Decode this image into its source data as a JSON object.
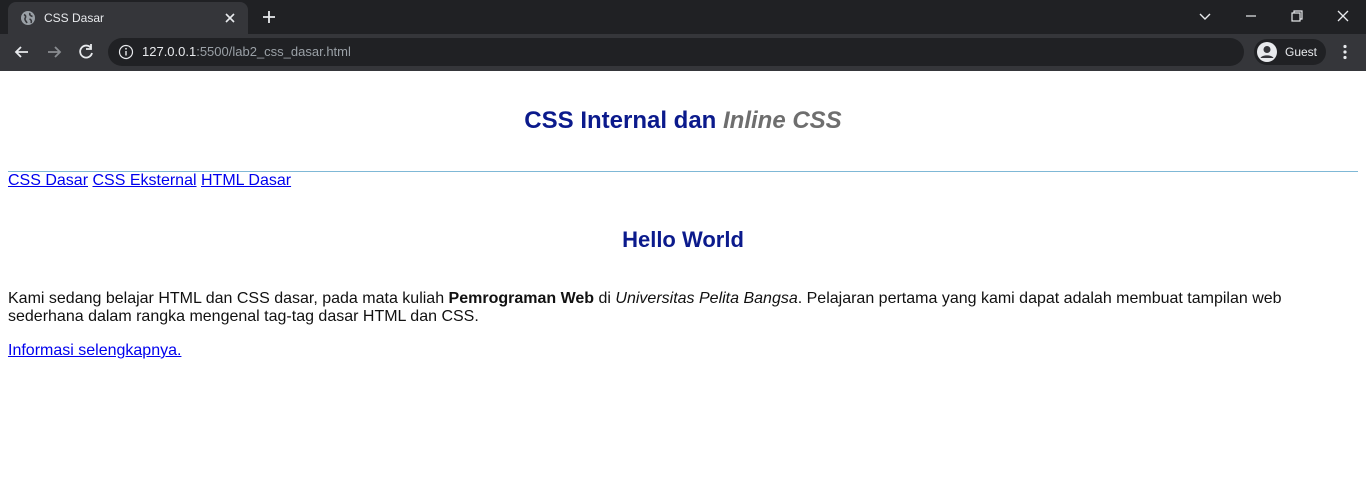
{
  "browser": {
    "tab_title": "CSS Dasar",
    "url_host": "127.0.0.1",
    "url_rest": ":5500/lab2_css_dasar.html",
    "profile_label": "Guest",
    "icons": [
      "globe-icon",
      "close-icon",
      "plus-icon",
      "chevron-down-icon",
      "minimize-icon",
      "restore-icon",
      "window-close-icon",
      "back-arrow-icon",
      "forward-arrow-icon",
      "reload-icon",
      "info-icon",
      "avatar-icon",
      "kebab-menu-icon"
    ]
  },
  "page": {
    "title_main": "CSS Internal dan ",
    "title_emph": "Inline CSS",
    "nav": [
      {
        "label": "CSS Dasar"
      },
      {
        "label": "CSS Eksternal"
      },
      {
        "label": "HTML Dasar"
      }
    ],
    "heading": "Hello World",
    "paragraph": {
      "part1": "Kami sedang belajar HTML dan CSS dasar, pada mata kuliah ",
      "bold": "Pemrograman Web",
      "part2": " di ",
      "italic": "Universitas Pelita Bangsa",
      "part3": ". Pelajaran pertama yang kami dapat adalah membuat tampilan web sederhana dalam rangka mengenal tag-tag dasar HTML dan CSS."
    },
    "more_link": "Informasi selengkapnya."
  },
  "colors": {
    "heading": "#0b1a8c",
    "emphasis": "#6e6e6e",
    "link": "#0000ee",
    "rule": "#7fb8d6",
    "chrome_dark": "#202124",
    "chrome_toolbar": "#35363a"
  }
}
